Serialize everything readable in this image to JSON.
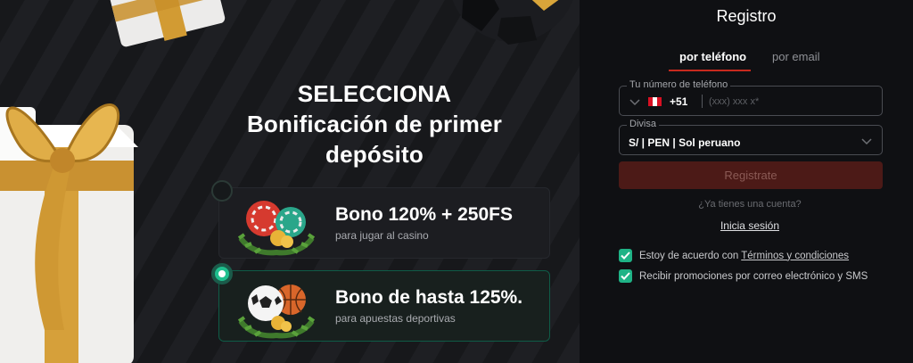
{
  "promo": {
    "title_lines": [
      "SELECCIONA",
      "Bonificación de primer",
      "depósito"
    ],
    "bonuses": [
      {
        "title": "Bono 120% + 250FS",
        "subtitle": "para jugar al casino",
        "selected": false,
        "icon": "casino-chips-icon"
      },
      {
        "title": "Bono de hasta 125%.",
        "subtitle": "para apuestas deportivas",
        "selected": true,
        "icon": "sports-balls-icon"
      }
    ]
  },
  "form": {
    "title": "Registro",
    "tabs": [
      {
        "label": "por teléfono",
        "active": true
      },
      {
        "label": "por email",
        "active": false
      }
    ],
    "phone": {
      "label": "Tu número de teléfono",
      "country_code": "+51",
      "flag": "peru-flag-icon",
      "placeholder": "(xxx) xxx x*"
    },
    "currency": {
      "label": "Divisa",
      "value": "S/ | PEN | Sol peruano"
    },
    "submit_label": "Registrate",
    "have_account": "¿Ya tienes una cuenta?",
    "login_label": "Inicia sesión",
    "agreements": {
      "terms_prefix": "Estoy de acuerdo con",
      "terms_link": "Términos y condiciones",
      "terms_checked": true,
      "promos": "Recibir promociones por correo electrónico y SMS",
      "promos_checked": true
    }
  },
  "colors": {
    "accent_red": "#c82a1e",
    "accent_green": "#1fb386",
    "panel_bg": "#0f1013",
    "gold": "#d9a53a"
  }
}
